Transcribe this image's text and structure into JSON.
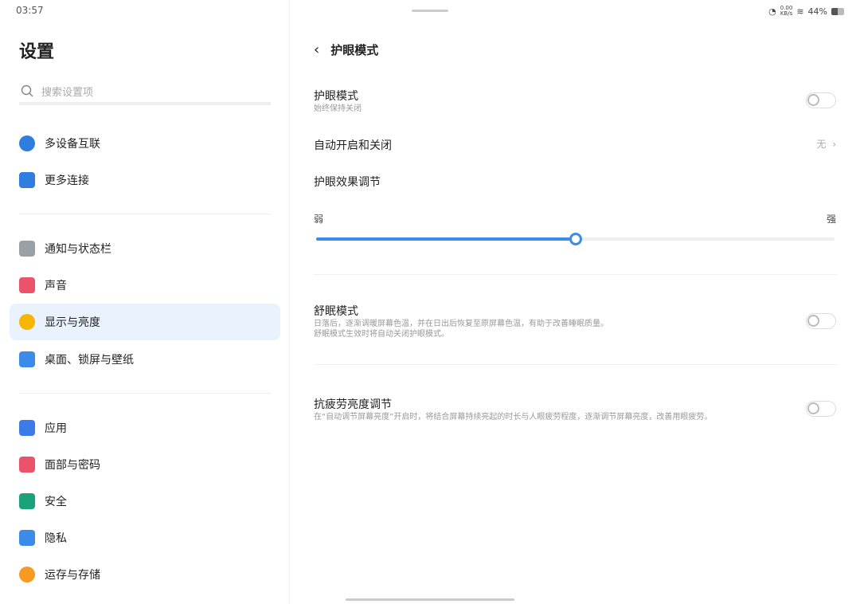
{
  "status_bar": {
    "time": "03:57",
    "speed": "0.00",
    "speed_unit": "KB/s",
    "battery": "44%"
  },
  "sidebar": {
    "title": "设置",
    "search_placeholder": "搜索设置项",
    "items": [
      {
        "label": "多设备互联",
        "icon": "multi-device-icon",
        "color": "#2f7de1"
      },
      {
        "label": "更多连接",
        "icon": "link-icon",
        "color": "#2f7de1"
      },
      {
        "label": "通知与状态栏",
        "icon": "notification-icon",
        "color": "#9aa0a6"
      },
      {
        "label": "声音",
        "icon": "speaker-icon",
        "color": "#e9546b"
      },
      {
        "label": "显示与亮度",
        "icon": "brightness-icon",
        "color": "#f7b500",
        "selected": true
      },
      {
        "label": "桌面、锁屏与壁纸",
        "icon": "wallpaper-icon",
        "color": "#3d8be8"
      },
      {
        "label": "应用",
        "icon": "apps-icon",
        "color": "#3d7be8"
      },
      {
        "label": "面部与密码",
        "icon": "face-icon",
        "color": "#e9546b"
      },
      {
        "label": "安全",
        "icon": "shield-icon",
        "color": "#1aa37a"
      },
      {
        "label": "隐私",
        "icon": "privacy-icon",
        "color": "#3d8be8"
      },
      {
        "label": "运存与存储",
        "icon": "storage-icon",
        "color": "#f59a23"
      }
    ]
  },
  "main": {
    "title": "护眼模式",
    "eye_mode": {
      "label": "护眼模式",
      "sub": "始终保持关闭",
      "on": false
    },
    "auto": {
      "label": "自动开启和关闭",
      "value": "无"
    },
    "effect": {
      "label": "护眼效果调节",
      "min": "弱",
      "max": "强",
      "value": 0.5
    },
    "sleep": {
      "label": "舒眠模式",
      "sub1": "日落后，逐渐调暖屏幕色温，并在日出后恢复至原屏幕色温，有助于改善睡眠质量。",
      "sub2": "舒眠模式生效时将自动关闭护眼模式。",
      "on": false
    },
    "fatigue": {
      "label": "抗疲劳亮度调节",
      "sub": "在“自动调节屏幕亮度”开启时，将结合屏幕持续亮起的时长与人眼疲劳程度，逐渐调节屏幕亮度，改善用眼疲劳。",
      "on": false
    }
  },
  "accent": "#3d8be8"
}
